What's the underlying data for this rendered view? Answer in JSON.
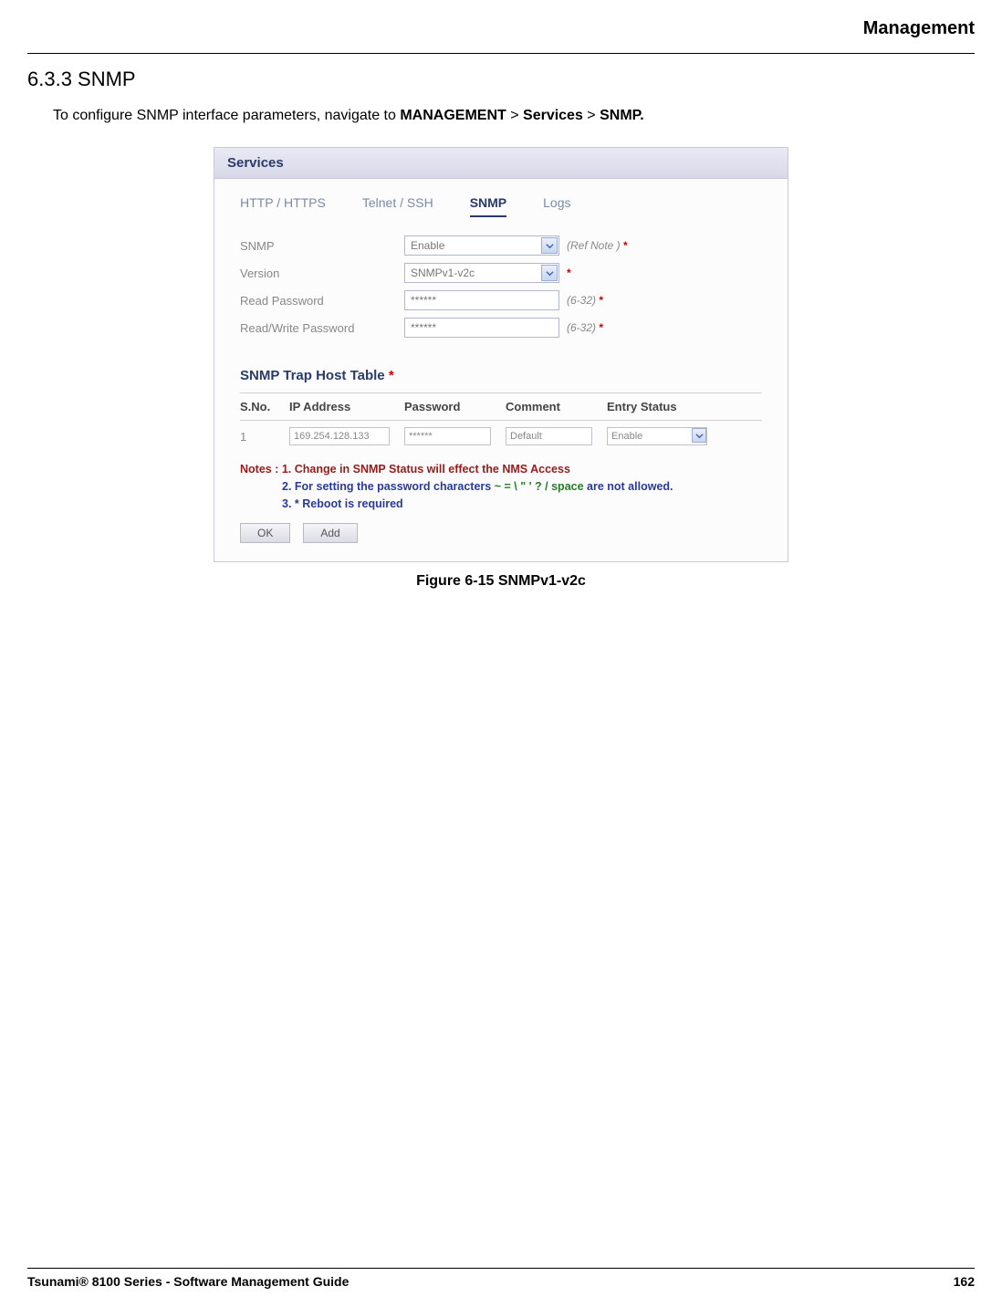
{
  "header": {
    "title": "Management"
  },
  "section": {
    "heading": "6.3.3 SNMP",
    "intro_prefix": "To configure SNMP interface parameters, navigate to ",
    "intro_path1": "MANAGEMENT",
    "intro_sep1": " > ",
    "intro_path2": "Services",
    "intro_sep2": " > ",
    "intro_path3": "SNMP."
  },
  "panel": {
    "title": "Services",
    "tabs": [
      "HTTP / HTTPS",
      "Telnet / SSH",
      "SNMP",
      "Logs"
    ],
    "active_tab": "SNMP",
    "fields": {
      "snmp": {
        "label": "SNMP",
        "value": "Enable",
        "hint": "(Ref Note )"
      },
      "version": {
        "label": "Version",
        "value": "SNMPv1-v2c",
        "hint": ""
      },
      "read_pw": {
        "label": "Read Password",
        "value": "******",
        "hint": "(6-32)"
      },
      "rw_pw": {
        "label": "Read/Write Password",
        "value": "******",
        "hint": "(6-32)"
      }
    },
    "trap_heading": "SNMP Trap Host Table",
    "trap_cols": {
      "sno": "S.No.",
      "ip": "IP Address",
      "pw": "Password",
      "cm": "Comment",
      "es": "Entry Status"
    },
    "trap_row": {
      "sno": "1",
      "ip": "169.254.128.133",
      "pw": "******",
      "cm": "Default",
      "es": "Enable"
    },
    "notes": {
      "prefix": "Notes : ",
      "n1": "1. Change in SNMP Status will effect the NMS Access",
      "n2a": "2. For setting the password characters   ",
      "n2b": "~ = \\ \" ' ? / space",
      "n2c": "   are not allowed.",
      "n3": "3. * Reboot is required"
    },
    "buttons": {
      "ok": "OK",
      "add": "Add"
    }
  },
  "figure_caption": "Figure 6-15 SNMPv1-v2c",
  "footer": {
    "left": "Tsunami® 8100 Series - Software Management Guide",
    "right": "162"
  }
}
